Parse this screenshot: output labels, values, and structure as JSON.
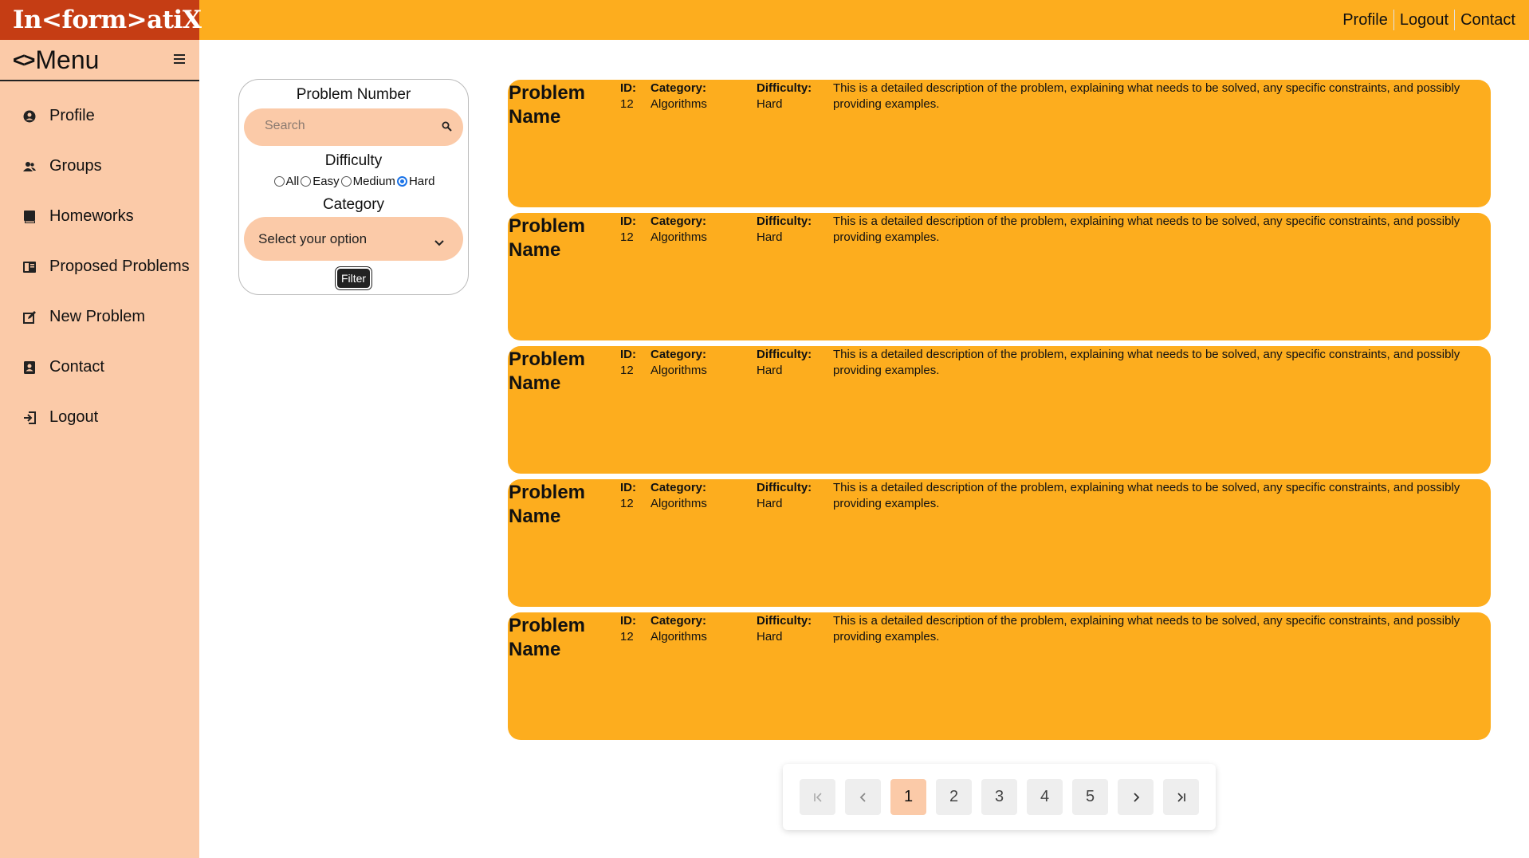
{
  "app": {
    "logo": "In<form>atiX"
  },
  "top_nav": [
    "Profile",
    "Logout",
    "Contact"
  ],
  "sidebar": {
    "menu_code": "<>",
    "menu_title": "Menu",
    "items": [
      {
        "label": "Profile",
        "icon": "profile-icon"
      },
      {
        "label": "Groups",
        "icon": "groups-icon"
      },
      {
        "label": "Homeworks",
        "icon": "book-icon"
      },
      {
        "label": "Proposed Problems",
        "icon": "proposed-icon"
      },
      {
        "label": "New Problem",
        "icon": "edit-icon"
      },
      {
        "label": "Contact",
        "icon": "contact-icon"
      },
      {
        "label": "Logout",
        "icon": "logout-icon"
      }
    ]
  },
  "filter": {
    "problem_number_label": "Problem Number",
    "search_placeholder": "Search",
    "difficulty_label": "Difficulty",
    "difficulty_options": [
      "All",
      "Easy",
      "Medium",
      "Hard"
    ],
    "difficulty_selected": "Hard",
    "category_label": "Category",
    "category_selected": "Select your option",
    "filter_button": "Filter"
  },
  "problems": [
    {
      "name": "Problem Name",
      "id_label": "ID:",
      "id": "12",
      "category_label": "Category:",
      "category": "Algorithms",
      "difficulty_label": "Difficulty:",
      "difficulty": "Hard",
      "description": "This is a detailed description of the problem, explaining what needs to be solved, any specific constraints, and possibly providing examples."
    },
    {
      "name": "Problem Name",
      "id_label": "ID:",
      "id": "12",
      "category_label": "Category:",
      "category": "Algorithms",
      "difficulty_label": "Difficulty:",
      "difficulty": "Hard",
      "description": "This is a detailed description of the problem, explaining what needs to be solved, any specific constraints, and possibly providing examples."
    },
    {
      "name": "Problem Name",
      "id_label": "ID:",
      "id": "12",
      "category_label": "Category:",
      "category": "Algorithms",
      "difficulty_label": "Difficulty:",
      "difficulty": "Hard",
      "description": "This is a detailed description of the problem, explaining what needs to be solved, any specific constraints, and possibly providing examples."
    },
    {
      "name": "Problem Name",
      "id_label": "ID:",
      "id": "12",
      "category_label": "Category:",
      "category": "Algorithms",
      "difficulty_label": "Difficulty:",
      "difficulty": "Hard",
      "description": "This is a detailed description of the problem, explaining what needs to be solved, any specific constraints, and possibly providing examples."
    },
    {
      "name": "Problem Name",
      "id_label": "ID:",
      "id": "12",
      "category_label": "Category:",
      "category": "Algorithms",
      "difficulty_label": "Difficulty:",
      "difficulty": "Hard",
      "description": "This is a detailed description of the problem, explaining what needs to be solved, any specific constraints, and possibly providing examples."
    }
  ],
  "pagination": {
    "pages": [
      "1",
      "2",
      "3",
      "4",
      "5"
    ],
    "current": "1",
    "controls": [
      "first-page-icon",
      "prev-page-icon",
      "next-page-icon",
      "last-page-icon"
    ]
  },
  "colors": {
    "accent": "#fdad1e",
    "brand": "#c53d14",
    "sidebar": "#fbcaa8"
  }
}
